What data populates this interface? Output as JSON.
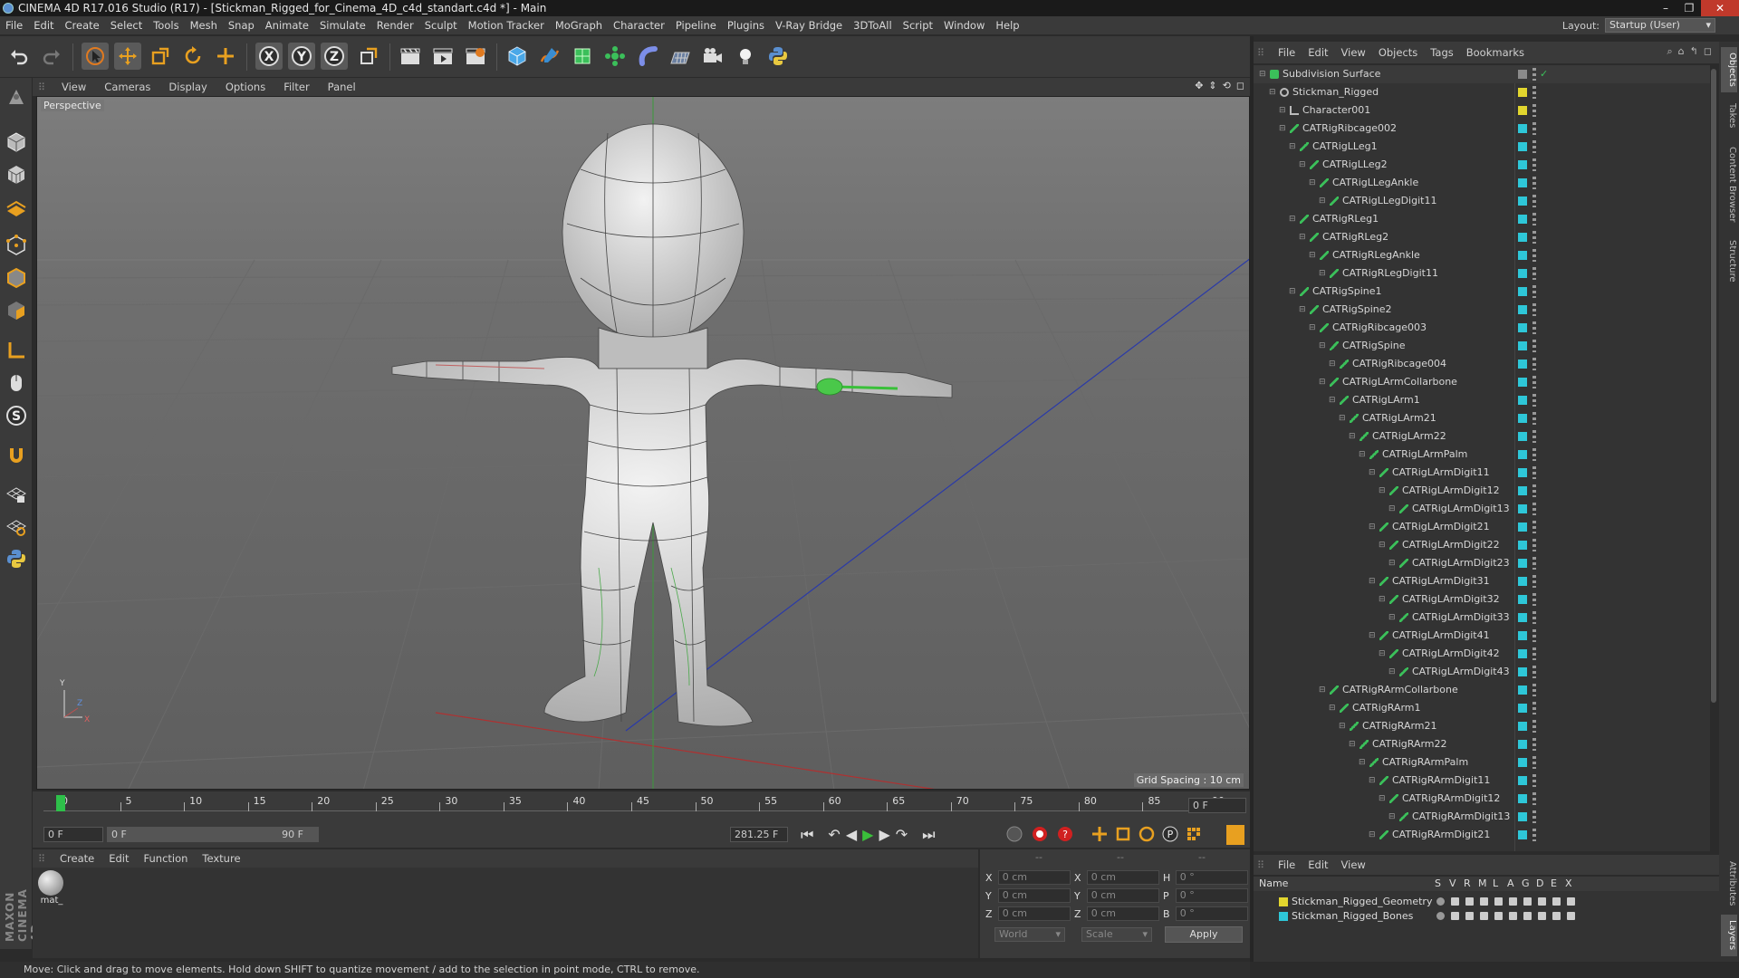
{
  "window": {
    "title": "CINEMA 4D R17.016 Studio (R17) - [Stickman_Rigged_for_Cinema_4D_c4d_standart.c4d *] - Main",
    "min": "–",
    "max": "❐",
    "close": "✕"
  },
  "menu": [
    "File",
    "Edit",
    "Create",
    "Select",
    "Tools",
    "Mesh",
    "Snap",
    "Animate",
    "Simulate",
    "Render",
    "Sculpt",
    "Motion Tracker",
    "MoGraph",
    "Character",
    "Pipeline",
    "Plugins",
    "V-Ray Bridge",
    "3DToAll",
    "Script",
    "Window",
    "Help"
  ],
  "layout": {
    "label": "Layout:",
    "value": "Startup (User)"
  },
  "viewport": {
    "menu": [
      "View",
      "Cameras",
      "Display",
      "Options",
      "Filter",
      "Panel"
    ],
    "label": "Perspective",
    "grid": "Grid Spacing : 10 cm"
  },
  "timeline": {
    "ticks": [
      "0",
      "5",
      "10",
      "15",
      "20",
      "25",
      "30",
      "35",
      "40",
      "45",
      "50",
      "55",
      "60",
      "65",
      "70",
      "75",
      "80",
      "85",
      "90"
    ],
    "current_frame": "0 F",
    "start_field": "0 F",
    "range_start": "0 F",
    "range_end": "90 F",
    "fps_field": "281.25 F"
  },
  "material": {
    "menu": [
      "Create",
      "Edit",
      "Function",
      "Texture"
    ],
    "items": [
      {
        "name": "mat_"
      }
    ]
  },
  "coords": {
    "headers": [
      "--",
      "--",
      "--"
    ],
    "rows": [
      {
        "a": "X",
        "av": "0 cm",
        "b": "X",
        "bv": "0 cm",
        "c": "H",
        "cv": "0 °"
      },
      {
        "a": "Y",
        "av": "0 cm",
        "b": "Y",
        "bv": "0 cm",
        "c": "P",
        "cv": "0 °"
      },
      {
        "a": "Z",
        "av": "0 cm",
        "b": "Z",
        "bv": "0 cm",
        "c": "B",
        "cv": "0 °"
      }
    ],
    "world": "World",
    "scale": "Scale",
    "apply": "Apply"
  },
  "status": "Move: Click and drag to move elements. Hold down SHIFT to quantize movement / add to the selection in point mode, CTRL to remove.",
  "objects": {
    "menu": [
      "File",
      "Edit",
      "View",
      "Objects",
      "Tags",
      "Bookmarks"
    ],
    "tree": [
      {
        "name": "Subdivision Surface",
        "depth": 0,
        "color": "#9a9a9a",
        "kind": "subd"
      },
      {
        "name": "Stickman_Rigged",
        "depth": 1,
        "color": "#e2d62e",
        "kind": "null"
      },
      {
        "name": "Character001",
        "depth": 2,
        "color": "#e2d62e",
        "kind": "char"
      },
      {
        "name": "CATRigRibcage002",
        "depth": 2,
        "color": "#2ec7d8",
        "kind": "bone"
      },
      {
        "name": "CATRigLLeg1",
        "depth": 3,
        "color": "#2ec7d8",
        "kind": "bone"
      },
      {
        "name": "CATRigLLeg2",
        "depth": 4,
        "color": "#2ec7d8",
        "kind": "bone"
      },
      {
        "name": "CATRigLLegAnkle",
        "depth": 5,
        "color": "#2ec7d8",
        "kind": "bone"
      },
      {
        "name": "CATRigLLegDigit11",
        "depth": 6,
        "color": "#2ec7d8",
        "kind": "bone"
      },
      {
        "name": "CATRigRLeg1",
        "depth": 3,
        "color": "#2ec7d8",
        "kind": "bone"
      },
      {
        "name": "CATRigRLeg2",
        "depth": 4,
        "color": "#2ec7d8",
        "kind": "bone"
      },
      {
        "name": "CATRigRLegAnkle",
        "depth": 5,
        "color": "#2ec7d8",
        "kind": "bone"
      },
      {
        "name": "CATRigRLegDigit11",
        "depth": 6,
        "color": "#2ec7d8",
        "kind": "bone"
      },
      {
        "name": "CATRigSpine1",
        "depth": 3,
        "color": "#2ec7d8",
        "kind": "bone"
      },
      {
        "name": "CATRigSpine2",
        "depth": 4,
        "color": "#2ec7d8",
        "kind": "bone"
      },
      {
        "name": "CATRigRibcage003",
        "depth": 5,
        "color": "#2ec7d8",
        "kind": "bone"
      },
      {
        "name": "CATRigSpine",
        "depth": 6,
        "color": "#2ec7d8",
        "kind": "bone"
      },
      {
        "name": "CATRigRibcage004",
        "depth": 7,
        "color": "#2ec7d8",
        "kind": "bone"
      },
      {
        "name": "CATRigLArmCollarbone",
        "depth": 6,
        "color": "#2ec7d8",
        "kind": "bone"
      },
      {
        "name": "CATRigLArm1",
        "depth": 7,
        "color": "#2ec7d8",
        "kind": "bone"
      },
      {
        "name": "CATRigLArm21",
        "depth": 8,
        "color": "#2ec7d8",
        "kind": "bone"
      },
      {
        "name": "CATRigLArm22",
        "depth": 9,
        "color": "#2ec7d8",
        "kind": "bone"
      },
      {
        "name": "CATRigLArmPalm",
        "depth": 10,
        "color": "#2ec7d8",
        "kind": "bone"
      },
      {
        "name": "CATRigLArmDigit11",
        "depth": 11,
        "color": "#2ec7d8",
        "kind": "bone"
      },
      {
        "name": "CATRigLArmDigit12",
        "depth": 12,
        "color": "#2ec7d8",
        "kind": "bone"
      },
      {
        "name": "CATRigLArmDigit13",
        "depth": 13,
        "color": "#2ec7d8",
        "kind": "bone"
      },
      {
        "name": "CATRigLArmDigit21",
        "depth": 11,
        "color": "#2ec7d8",
        "kind": "bone"
      },
      {
        "name": "CATRigLArmDigit22",
        "depth": 12,
        "color": "#2ec7d8",
        "kind": "bone"
      },
      {
        "name": "CATRigLArmDigit23",
        "depth": 13,
        "color": "#2ec7d8",
        "kind": "bone"
      },
      {
        "name": "CATRigLArmDigit31",
        "depth": 11,
        "color": "#2ec7d8",
        "kind": "bone"
      },
      {
        "name": "CATRigLArmDigit32",
        "depth": 12,
        "color": "#2ec7d8",
        "kind": "bone"
      },
      {
        "name": "CATRigLArmDigit33",
        "depth": 13,
        "color": "#2ec7d8",
        "kind": "bone"
      },
      {
        "name": "CATRigLArmDigit41",
        "depth": 11,
        "color": "#2ec7d8",
        "kind": "bone"
      },
      {
        "name": "CATRigLArmDigit42",
        "depth": 12,
        "color": "#2ec7d8",
        "kind": "bone"
      },
      {
        "name": "CATRigLArmDigit43",
        "depth": 13,
        "color": "#2ec7d8",
        "kind": "bone"
      },
      {
        "name": "CATRigRArmCollarbone",
        "depth": 6,
        "color": "#2ec7d8",
        "kind": "bone"
      },
      {
        "name": "CATRigRArm1",
        "depth": 7,
        "color": "#2ec7d8",
        "kind": "bone"
      },
      {
        "name": "CATRigRArm21",
        "depth": 8,
        "color": "#2ec7d8",
        "kind": "bone"
      },
      {
        "name": "CATRigRArm22",
        "depth": 9,
        "color": "#2ec7d8",
        "kind": "bone"
      },
      {
        "name": "CATRigRArmPalm",
        "depth": 10,
        "color": "#2ec7d8",
        "kind": "bone"
      },
      {
        "name": "CATRigRArmDigit11",
        "depth": 11,
        "color": "#2ec7d8",
        "kind": "bone"
      },
      {
        "name": "CATRigRArmDigit12",
        "depth": 12,
        "color": "#2ec7d8",
        "kind": "bone"
      },
      {
        "name": "CATRigRArmDigit13",
        "depth": 13,
        "color": "#2ec7d8",
        "kind": "bone"
      },
      {
        "name": "CATRigRArmDigit21",
        "depth": 11,
        "color": "#2ec7d8",
        "kind": "bone"
      }
    ]
  },
  "layers": {
    "menu": [
      "File",
      "Edit",
      "View"
    ],
    "columns": [
      "Name",
      "S",
      "V",
      "R",
      "M",
      "L",
      "A",
      "G",
      "D",
      "E",
      "X"
    ],
    "rows": [
      {
        "name": "Stickman_Rigged_Geometry",
        "color": "#e2d62e"
      },
      {
        "name": "Stickman_Rigged_Bones",
        "color": "#2ec7d8"
      }
    ]
  },
  "side_tabs": [
    "Objects",
    "Takes",
    "Content Browser",
    "Structure",
    "Attributes",
    "Layers"
  ],
  "brand": "MAXON CINEMA 4D"
}
